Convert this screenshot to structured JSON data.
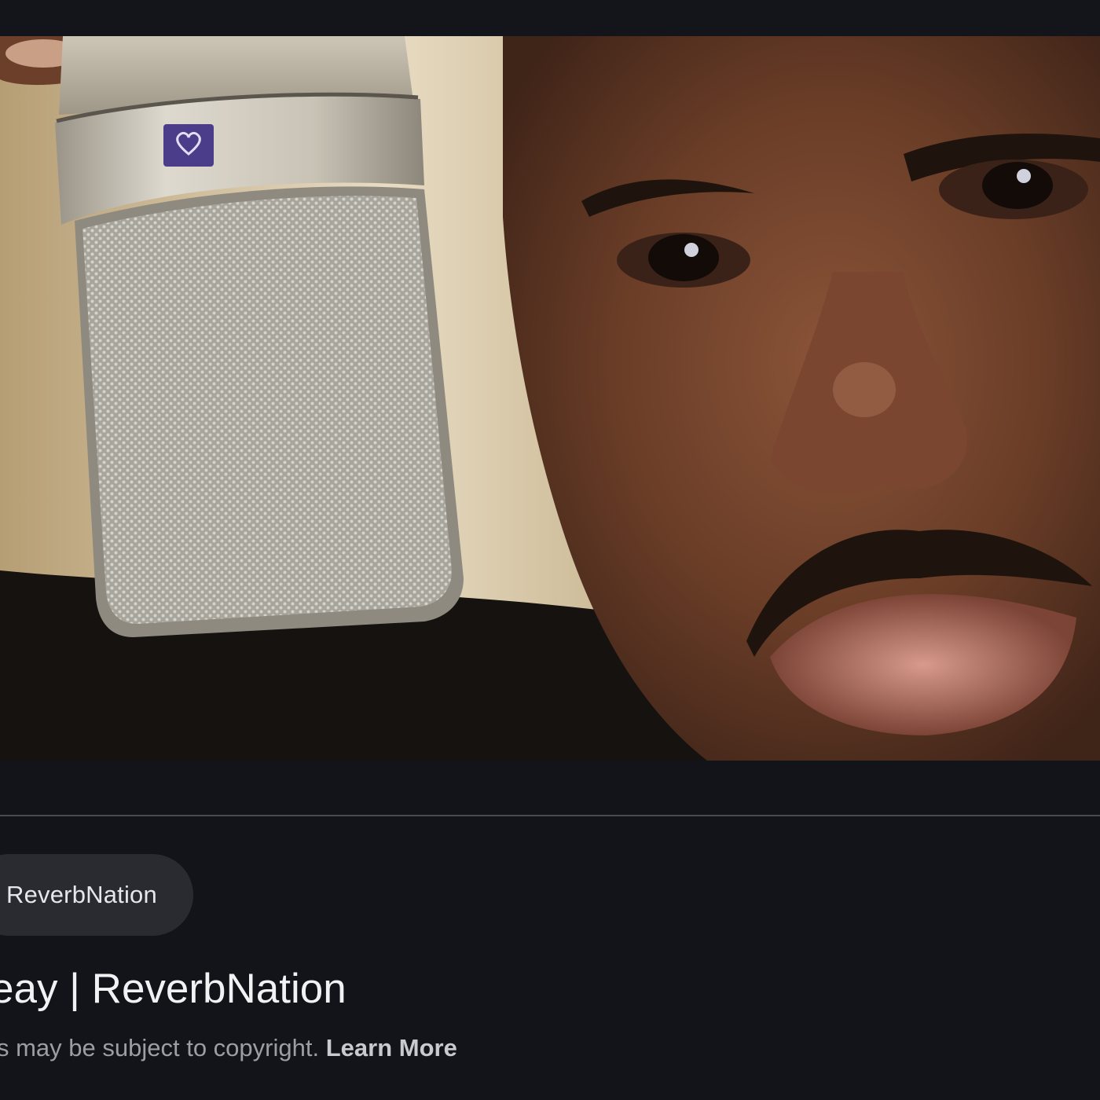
{
  "image": {
    "alt": "Man holding a large diaphragm studio condenser microphone"
  },
  "source": {
    "name": "ReverbNation"
  },
  "result": {
    "title": "eay | ReverbNation"
  },
  "notice": {
    "text": "s may be subject to copyright.",
    "link_label": "Learn More"
  },
  "colors": {
    "background": "#13141a",
    "chip_background": "#2a2b31",
    "title_text": "#f1f2f4",
    "muted_text": "#9d9ea4"
  }
}
